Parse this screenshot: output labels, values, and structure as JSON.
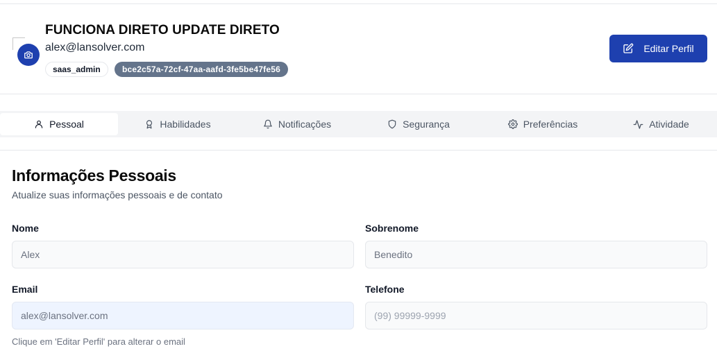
{
  "profile": {
    "name": "FUNCIONA DIRETO UPDATE DIRETO",
    "email": "alex@lansolver.com",
    "role_badge": "saas_admin",
    "id_badge": "bce2c57a-72cf-47aa-aafd-3fe5be47fe56",
    "avatar_icon": "camera-icon"
  },
  "header": {
    "edit_button_label": "Editar Perfil",
    "edit_button_icon": "edit-icon"
  },
  "tabs": [
    {
      "label": "Pessoal",
      "icon": "user-icon",
      "active": true
    },
    {
      "label": "Habilidades",
      "icon": "award-icon",
      "active": false
    },
    {
      "label": "Notificações",
      "icon": "bell-icon",
      "active": false
    },
    {
      "label": "Segurança",
      "icon": "shield-icon",
      "active": false
    },
    {
      "label": "Preferências",
      "icon": "gear-icon",
      "active": false
    },
    {
      "label": "Atividade",
      "icon": "activity-icon",
      "active": false
    }
  ],
  "section": {
    "title": "Informações Pessoais",
    "subtitle": "Atualize suas informações pessoais e de contato"
  },
  "form": {
    "first_name": {
      "label": "Nome",
      "value": "Alex"
    },
    "last_name": {
      "label": "Sobrenome",
      "value": "Benedito"
    },
    "email": {
      "label": "Email",
      "value": "alex@lansolver.com"
    },
    "phone": {
      "label": "Telefone",
      "value": "",
      "placeholder": "(99) 99999-9999"
    },
    "email_hint": "Clique em 'Editar Perfil' para alterar o email"
  },
  "colors": {
    "primary": "#1e40af",
    "id_badge_bg": "#64748b",
    "tabbar_bg": "#f3f4f6"
  }
}
